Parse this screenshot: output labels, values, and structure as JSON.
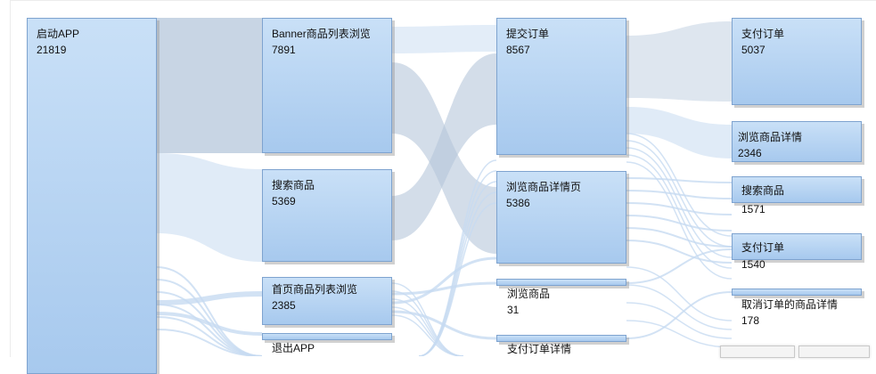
{
  "chart_data": {
    "type": "sankey",
    "columns": [
      [
        {
          "id": "launch",
          "name": "启动APP",
          "value": 21819
        }
      ],
      [
        {
          "id": "banner",
          "name": "Banner商品列表浏览",
          "value": 7891
        },
        {
          "id": "search1",
          "name": "搜索商品",
          "value": 5369
        },
        {
          "id": "home",
          "name": "首页商品列表浏览",
          "value": 2385
        },
        {
          "id": "exit",
          "name": "退出APP",
          "value": null
        }
      ],
      [
        {
          "id": "order",
          "name": "提交订单",
          "value": 8567
        },
        {
          "id": "detailpage",
          "name": "浏览商品详情页",
          "value": 5386
        },
        {
          "id": "browse",
          "name": "浏览商品",
          "value": 31
        },
        {
          "id": "paydetail",
          "name": "支付订单详情",
          "value": null
        }
      ],
      [
        {
          "id": "pay1",
          "name": "支付订单",
          "value": 5037
        },
        {
          "id": "detail2",
          "name": "浏览商品详情",
          "value": 2346
        },
        {
          "id": "search2",
          "name": "搜索商品",
          "value": 1571
        },
        {
          "id": "pay2",
          "name": "支付订单",
          "value": 1540
        },
        {
          "id": "cancel",
          "name": "取消订单的商品详情",
          "value": 178
        }
      ]
    ],
    "links": [
      {
        "source": "launch",
        "target": "banner"
      },
      {
        "source": "launch",
        "target": "search1"
      },
      {
        "source": "launch",
        "target": "home"
      },
      {
        "source": "launch",
        "target": "exit"
      },
      {
        "source": "banner",
        "target": "order"
      },
      {
        "source": "banner",
        "target": "detailpage"
      },
      {
        "source": "search1",
        "target": "order"
      },
      {
        "source": "search1",
        "target": "detailpage"
      },
      {
        "source": "home",
        "target": "detailpage"
      },
      {
        "source": "home",
        "target": "browse"
      },
      {
        "source": "home",
        "target": "paydetail"
      },
      {
        "source": "order",
        "target": "pay1"
      },
      {
        "source": "order",
        "target": "detail2"
      },
      {
        "source": "detailpage",
        "target": "search2"
      },
      {
        "source": "detailpage",
        "target": "pay2"
      },
      {
        "source": "detailpage",
        "target": "cancel"
      },
      {
        "source": "browse",
        "target": "pay2"
      },
      {
        "source": "paydetail",
        "target": "cancel"
      }
    ]
  },
  "colors": {
    "node_top": "#c9e0f7",
    "node_bottom": "#a7c9ee",
    "node_border": "#7ea3cf",
    "link_dark": "#b5c7db",
    "link_light": "#c7dbf1"
  }
}
